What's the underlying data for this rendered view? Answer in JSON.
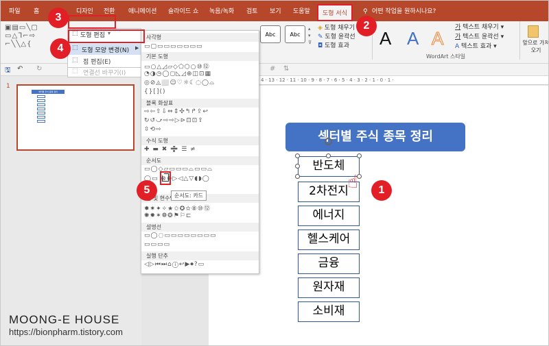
{
  "tabs": [
    "파일",
    "홈",
    "디자인",
    "전환",
    "애니메이션",
    "슬라이드 쇼",
    "녹음/녹화",
    "검토",
    "보기",
    "도움말",
    "도형 서식"
  ],
  "tellme": "어떤 작업을 원하시나요?",
  "menu": {
    "edit_shape": "도형 편집",
    "change_shape": "도형 모양 변경(N)",
    "edit_points": "점 편집(E)",
    "reroute": "연결선 바꾸기(I)"
  },
  "ribbon": {
    "fill": "도형 채우기",
    "outline": "도형 윤곽선",
    "effects": "도형 효과",
    "text_fill": "텍스트 채우기",
    "text_outline": "텍스트 윤곽선",
    "text_effects": "텍스트 효과",
    "wordart_group": "WordArt 스타일",
    "bring_forward": "앞으로 가져오기",
    "abc": "Abc",
    "wordart_letter": "A"
  },
  "gallery": {
    "sections": [
      "사각형",
      "기본 도형",
      "블록 화살표",
      "수식 도형",
      "순서도",
      "별 및 현수막",
      "설명선",
      "실행 단추"
    ],
    "rows": {
      "rect": "▭▢▭▭▭▭▭▭▭",
      "basic1": "▭○△◿▱◇⬠⬡○⑩⑫",
      "basic2": "◔◑◷◯◻◺◿⊕◫⊡▦",
      "basic3": "◎⊘◬⬜☺♡☼☾◌◯⌓",
      "basic4": "{}[]()",
      "arrow1": "⇨⇦⇧⇩⇔⇕✣↰↱⇪↩",
      "arrow2": "↻↺⤻⇨⇨▷⊳⊡⊡⇧",
      "arrow3": "⇳⟲⇨",
      "eq": "✚ ▬ ✖ ➗ ☰ ≠",
      "flow1": "▭◯◇▱▭▭▭⌓▭▭⌓",
      "flow2": "◯▭ ⊗⊕▷◁△▽◖◗◯",
      "star1": "✸✷✦✧★✩✪✫⑧⑩⑫",
      "star2": "✺✹✶❁❂⚑⚐⊏",
      "callout1": "▭◯◌▭▭▭▭▭▭▭▭",
      "callout2": "▭▭▭▭",
      "action": "◁▷⏮⏭⌂ⓘ↩▶⏺?▭"
    },
    "tooltip": "순서도: 카드"
  },
  "slide": {
    "title": "섹터별 주식 종목 정리",
    "items": [
      "반도체",
      "2차전지",
      "에너지",
      "헬스케어",
      "금융",
      "원자재",
      "소비재"
    ]
  },
  "thumb": {
    "number": "1",
    "title": "섹터별 주식 종목 정리"
  },
  "ruler": "4 · 13 · 12 · 11 · 10 · 9 · 8 · 7 · 6 · 5 · 4 · 3 · 2 · 1 · 0 · 1 ·",
  "badges": [
    "1",
    "2",
    "3",
    "4",
    "5"
  ],
  "watermark": {
    "name": "MOONG-E HOUSE",
    "url": "https://bionpharm.tistory.com"
  },
  "colors": {
    "accent": "#b7472a",
    "title_fill": "#4472c4",
    "box_border": "#2f5597",
    "highlight": "#e21f26"
  }
}
